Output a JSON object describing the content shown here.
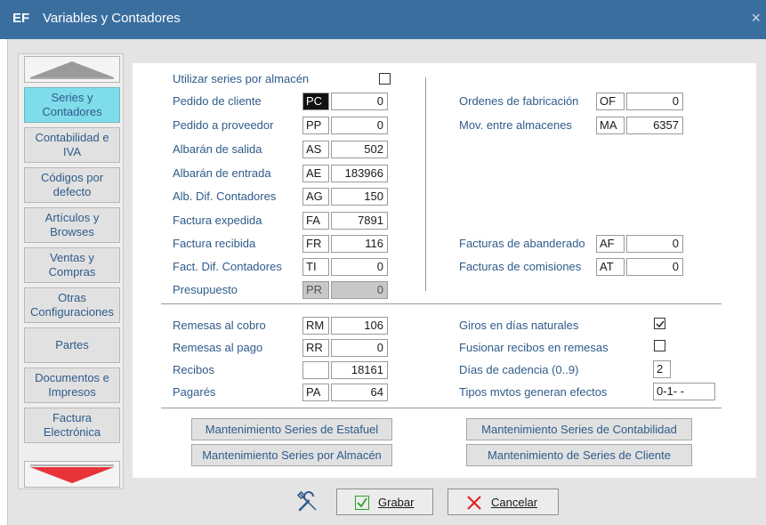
{
  "window": {
    "logo": "EF",
    "title": "Variables y Contadores",
    "close": "×"
  },
  "sidebar": {
    "items": [
      {
        "label": "Series y\nContadores"
      },
      {
        "label": "Contabilidad e\nIVA"
      },
      {
        "label": "Códigos por\ndefecto"
      },
      {
        "label": "Artículos y\nBrowses"
      },
      {
        "label": "Ventas y\nCompras"
      },
      {
        "label": "Otras\nConfiguraciones"
      },
      {
        "label": "Partes"
      },
      {
        "label": "Documentos e\nImpresos"
      },
      {
        "label": "Factura\nElectrónica"
      }
    ]
  },
  "form": {
    "utilizar_series": {
      "label": "Utilizar series por almacén",
      "checked": false
    },
    "left_rows": [
      {
        "label": "Pedido de cliente",
        "code": "PC",
        "value": "0"
      },
      {
        "label": "Pedido a proveedor",
        "code": "PP",
        "value": "0"
      },
      {
        "label": "Albarán de salida",
        "code": "AS",
        "value": "502"
      },
      {
        "label": "Albarán de entrada",
        "code": "AE",
        "value": "183966"
      },
      {
        "label": "Alb. Dif. Contadores",
        "code": "AG",
        "value": "150"
      },
      {
        "label": "Factura expedida",
        "code": "FA",
        "value": "7891"
      },
      {
        "label": "Factura recibida",
        "code": "FR",
        "value": "116"
      },
      {
        "label": "Fact. Dif. Contadores",
        "code": "TI",
        "value": "0"
      },
      {
        "label": "Presupuesto",
        "code": "PR",
        "value": "0"
      }
    ],
    "right_rows": [
      {
        "label": "Ordenes de fabricación",
        "code": "OF",
        "value": "0"
      },
      {
        "label": "Mov. entre almacenes",
        "code": "MA",
        "value": "6357"
      },
      {
        "label": "Facturas de abanderado",
        "code": "AF",
        "value": "0"
      },
      {
        "label": "Facturas de comisiones",
        "code": "AT",
        "value": "0"
      }
    ],
    "remesas_rows": [
      {
        "label": "Remesas al cobro",
        "code": "RM",
        "value": "106"
      },
      {
        "label": "Remesas al pago",
        "code": "RR",
        "value": "0"
      },
      {
        "label": "Recibos",
        "code": "",
        "value": "18161"
      },
      {
        "label": "Pagarés",
        "code": "PA",
        "value": "64"
      }
    ],
    "giros": {
      "label": "Giros en días naturales",
      "checked": true
    },
    "fusionar": {
      "label": "Fusionar recibos en remesas",
      "checked": false
    },
    "cadencia": {
      "label": "Días de cadencia (0..9)",
      "value": "2"
    },
    "tipos": {
      "label": "Tipos mvtos generan efectos",
      "value": "0-1- -"
    }
  },
  "buttons": {
    "mant_estafuel": "Mantenimiento Series de Estafuel",
    "mant_contabilidad": "Mantenimiento Series de Contabilidad",
    "mant_almacen": "Mantenimiento Series por Almacén",
    "mant_cliente": "Mantenimiento de Series de Cliente"
  },
  "actions": {
    "grabar": "Grabar",
    "cancelar": "Cancelar"
  },
  "colors": {
    "titlebar": "#3a6e9f",
    "label": "#2f5b8a",
    "active_tab": "#7fdcea",
    "cancel_x": "#e02020",
    "save_check": "#2aa02a"
  }
}
